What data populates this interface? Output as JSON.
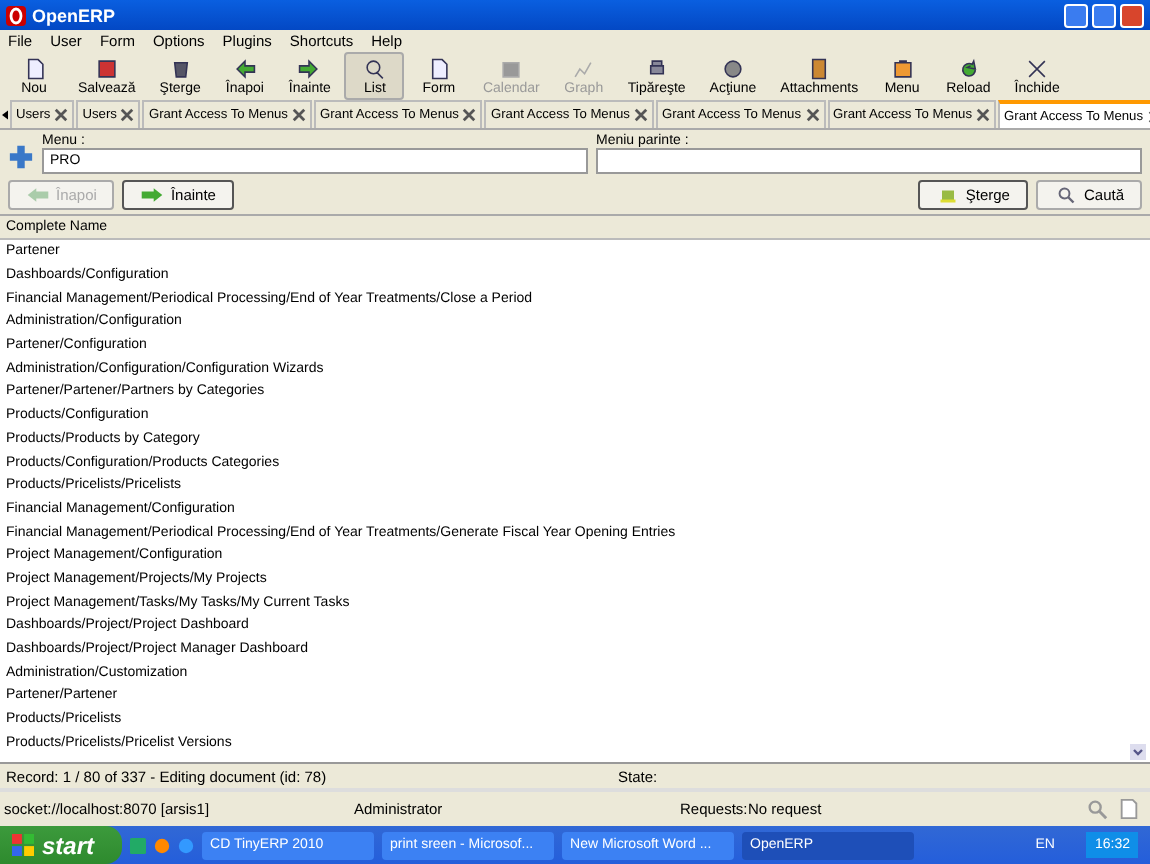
{
  "window": {
    "title": "OpenERP"
  },
  "menu": [
    "File",
    "User",
    "Form",
    "Options",
    "Plugins",
    "Shortcuts",
    "Help"
  ],
  "toolbar": [
    {
      "label": "Nou",
      "selected": false,
      "disabled": false
    },
    {
      "label": "Salvează",
      "selected": false,
      "disabled": false
    },
    {
      "label": "Şterge",
      "selected": false,
      "disabled": false
    },
    {
      "label": "Înapoi",
      "selected": false,
      "disabled": false
    },
    {
      "label": "Înainte",
      "selected": false,
      "disabled": false
    },
    {
      "label": "List",
      "selected": true,
      "disabled": false
    },
    {
      "label": "Form",
      "selected": false,
      "disabled": false
    },
    {
      "label": "Calendar",
      "selected": false,
      "disabled": true
    },
    {
      "label": "Graph",
      "selected": false,
      "disabled": true
    },
    {
      "label": "Tipăreşte",
      "selected": false,
      "disabled": false
    },
    {
      "label": "Acţiune",
      "selected": false,
      "disabled": false
    },
    {
      "label": "Attachments",
      "selected": false,
      "disabled": false
    },
    {
      "label": "Menu",
      "selected": false,
      "disabled": false
    },
    {
      "label": "Reload",
      "selected": false,
      "disabled": false
    },
    {
      "label": "Închide",
      "selected": false,
      "disabled": false
    }
  ],
  "tabs": [
    {
      "label": "Users",
      "selected": false
    },
    {
      "label": "Users",
      "selected": false
    },
    {
      "label": "Grant Access To Menus",
      "selected": false
    },
    {
      "label": "Grant Access To Menus",
      "selected": false
    },
    {
      "label": "Grant Access To Menus",
      "selected": false
    },
    {
      "label": "Grant Access To Menus",
      "selected": false
    },
    {
      "label": "Grant Access To Menus",
      "selected": false
    },
    {
      "label": "Grant Access To Menus",
      "selected": true
    }
  ],
  "search_form": {
    "fields": [
      {
        "label": "Menu :",
        "value": "PRO"
      },
      {
        "label": "Meniu parinte :"
      }
    ],
    "back_button": {
      "label": "Înapoi",
      "disabled": true
    },
    "next_button": {
      "label": "Înainte",
      "disabled": false
    },
    "clear_button": "Şterge",
    "search_button": "Caută"
  },
  "table": {
    "columns": [
      "Complete Name"
    ],
    "rows": [
      "Partener",
      "Dashboards/Configuration",
      "Financial Management/Periodical Processing/End of Year Treatments/Close a Period",
      "Administration/Configuration",
      "Partener/Configuration",
      "Administration/Configuration/Configuration Wizards",
      "Partener/Partener/Partners by Categories",
      "Products/Configuration",
      "Products/Products by Category",
      "Products/Configuration/Products Categories",
      "Products/Pricelists/Pricelists",
      "Financial Management/Configuration",
      "Financial Management/Periodical Processing/End of Year Treatments/Generate Fiscal Year Opening Entries",
      "Project Management/Configuration",
      "Project Management/Projects/My Projects",
      "Project Management/Tasks/My Tasks/My Current Tasks",
      "Dashboards/Project/Project Dashboard",
      "Dashboards/Project/Project Manager Dashboard",
      "Administration/Customization",
      "Partener/Partener",
      "Products/Pricelists",
      "Products/Pricelists/Pricelist Versions"
    ]
  },
  "record_bar": {
    "record": "Record: 1 / 80 of 337 - Editing document (id: 78)",
    "state": "State:"
  },
  "status_bar": {
    "server": "socket://localhost:8070 [arsis1]",
    "user": "Administrator",
    "requests_label": "Requests:",
    "requests": "No request"
  },
  "taskbar": {
    "start": "start",
    "items": [
      {
        "label": "CD TinyERP 2010",
        "selected": false
      },
      {
        "label": "print sreen - Microsof...",
        "selected": false
      },
      {
        "label": "New Microsoft Word ...",
        "selected": false
      },
      {
        "label": "OpenERP",
        "selected": true
      }
    ],
    "language": "EN",
    "clock": "16:32"
  }
}
